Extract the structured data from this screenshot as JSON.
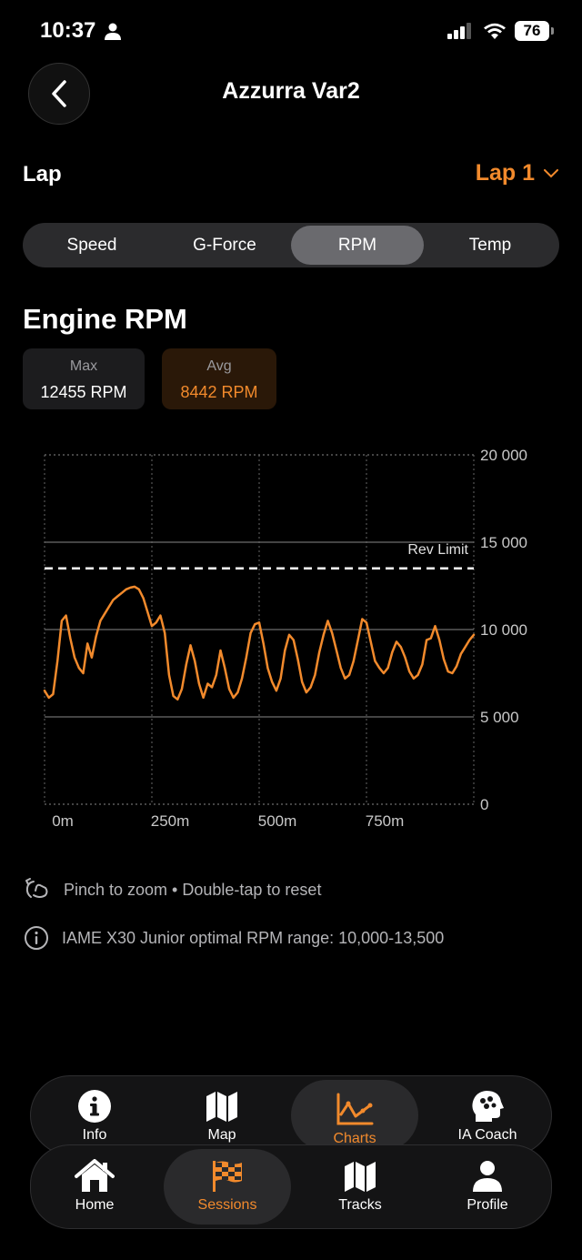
{
  "status": {
    "time": "10:37",
    "battery": "76"
  },
  "header": {
    "title": "Azzurra Var2"
  },
  "lap": {
    "label": "Lap",
    "selected": "Lap 1"
  },
  "segments": [
    {
      "label": "Speed"
    },
    {
      "label": "G-Force"
    },
    {
      "label": "RPM"
    },
    {
      "label": "Temp"
    }
  ],
  "section": {
    "title": "Engine RPM"
  },
  "stats": {
    "max": {
      "label": "Max",
      "value": "12455 RPM"
    },
    "avg": {
      "label": "Avg",
      "value": "8442 RPM"
    }
  },
  "chart_data": {
    "type": "line",
    "x_unit": "m",
    "y_ticks": [
      "20 000",
      "15 000",
      "10 000",
      "5 000",
      "0"
    ],
    "x_ticks": [
      "0m",
      "250m",
      "500m",
      "750m"
    ],
    "ylim": [
      0,
      20000
    ],
    "xlim": [
      0,
      1000
    ],
    "threshold": {
      "label": "Rev Limit",
      "value": 13500
    },
    "series": [
      {
        "color": "#f28a2c",
        "x": [
          0,
          10,
          20,
          30,
          40,
          50,
          60,
          70,
          80,
          90,
          100,
          110,
          120,
          130,
          140,
          150,
          160,
          170,
          180,
          190,
          200,
          210,
          220,
          230,
          240,
          250,
          260,
          270,
          280,
          290,
          300,
          310,
          320,
          330,
          340,
          350,
          360,
          370,
          380,
          390,
          400,
          410,
          420,
          430,
          440,
          450,
          460,
          470,
          480,
          490,
          500,
          510,
          520,
          530,
          540,
          550,
          560,
          570,
          580,
          590,
          600,
          610,
          620,
          630,
          640,
          650,
          660,
          670,
          680,
          690,
          700,
          710,
          720,
          730,
          740,
          750,
          760,
          770,
          780,
          790,
          800,
          810,
          820,
          830,
          840,
          850,
          860,
          870,
          880,
          890,
          900,
          910,
          920,
          930,
          940,
          950,
          960,
          970,
          980,
          990,
          1000
        ],
        "values": [
          6500,
          6100,
          6300,
          8200,
          10500,
          10800,
          9500,
          8400,
          7800,
          7500,
          9200,
          8400,
          9600,
          10500,
          10900,
          11300,
          11700,
          11900,
          12100,
          12300,
          12400,
          12455,
          12300,
          11800,
          11000,
          10200,
          10400,
          10800,
          9800,
          7400,
          6200,
          6000,
          6600,
          8000,
          9100,
          8200,
          6900,
          6100,
          6900,
          6700,
          7400,
          8800,
          7800,
          6600,
          6100,
          6400,
          7200,
          8400,
          9800,
          10300,
          10400,
          9200,
          7800,
          7000,
          6500,
          7200,
          8800,
          9700,
          9400,
          8300,
          7000,
          6400,
          6700,
          7400,
          8700,
          9700,
          10500,
          9800,
          8800,
          7800,
          7200,
          7400,
          8200,
          9400,
          10600,
          10400,
          9300,
          8200,
          7800,
          7500,
          7800,
          8700,
          9300,
          9000,
          8400,
          7600,
          7200,
          7400,
          8000,
          9400,
          9500,
          10200,
          9400,
          8300,
          7600,
          7500,
          7900,
          8600,
          9000,
          9400,
          9700
        ]
      }
    ],
    "grid": true
  },
  "hints": {
    "zoom": "Pinch to zoom • Double-tap to reset",
    "info": "IAME X30 Junior optimal RPM range: 10,000-13,500"
  },
  "tabbar_top": [
    {
      "label": "Info",
      "icon": "info-icon"
    },
    {
      "label": "Map",
      "icon": "map-icon"
    },
    {
      "label": "Charts",
      "icon": "chart-icon"
    },
    {
      "label": "IA Coach",
      "icon": "brain-icon"
    }
  ],
  "tabbar_bottom": [
    {
      "label": "Home",
      "icon": "home-icon"
    },
    {
      "label": "Sessions",
      "icon": "checkered-flag-icon"
    },
    {
      "label": "Tracks",
      "icon": "map-icon"
    },
    {
      "label": "Profile",
      "icon": "person-icon"
    }
  ],
  "colors": {
    "accent": "#f28a2c",
    "background": "#000000"
  }
}
